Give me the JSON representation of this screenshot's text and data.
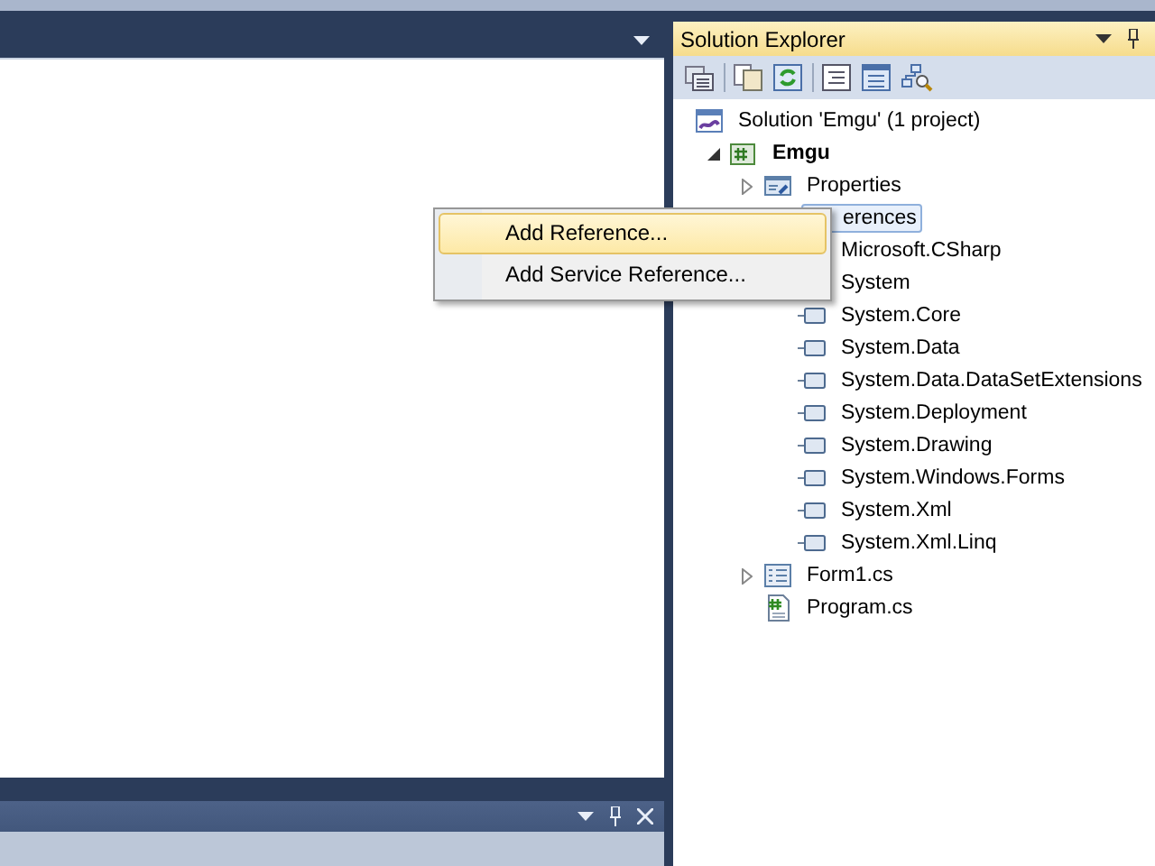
{
  "solution_explorer": {
    "title": "Solution Explorer",
    "tree": [
      {
        "label": "Solution 'Emgu' (1 project)",
        "kind": "solution",
        "children": [
          {
            "label": "Emgu",
            "kind": "csproject",
            "bold": true,
            "expanded": true,
            "children": [
              {
                "label": "Properties",
                "kind": "properties",
                "expanded": false
              },
              {
                "label": "erences",
                "selected": true,
                "children": [
                  {
                    "label": "Microsoft.CSharp"
                  },
                  {
                    "label": "System"
                  },
                  {
                    "label": "System.Core",
                    "kind": "reference"
                  },
                  {
                    "label": "System.Data",
                    "kind": "reference"
                  },
                  {
                    "label": "System.Data.DataSetExtensions",
                    "kind": "reference"
                  },
                  {
                    "label": "System.Deployment",
                    "kind": "reference"
                  },
                  {
                    "label": "System.Drawing",
                    "kind": "reference"
                  },
                  {
                    "label": "System.Windows.Forms",
                    "kind": "reference"
                  },
                  {
                    "label": "System.Xml",
                    "kind": "reference"
                  },
                  {
                    "label": "System.Xml.Linq",
                    "kind": "reference"
                  }
                ]
              },
              {
                "label": "Form1.cs",
                "kind": "form",
                "expanded": false
              },
              {
                "label": "Program.cs",
                "kind": "csfile"
              }
            ]
          }
        ]
      }
    ]
  },
  "context_menu": [
    {
      "label": "Add Reference...",
      "selected": true
    },
    {
      "label": "Add Service Reference...",
      "selected": false
    }
  ]
}
